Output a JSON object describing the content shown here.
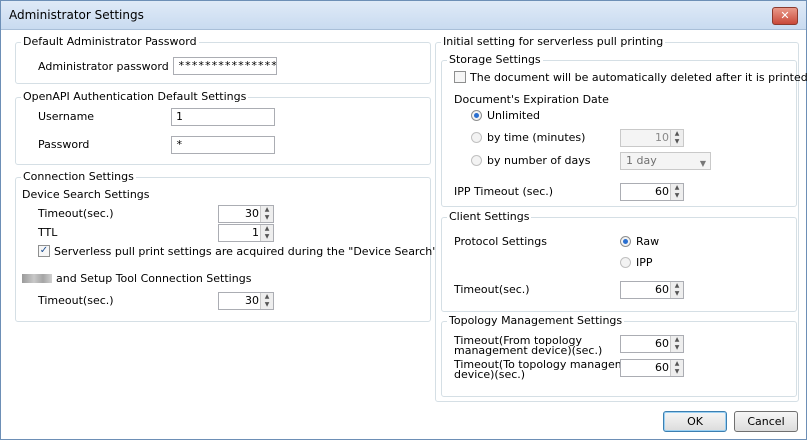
{
  "window": {
    "title": "Administrator Settings",
    "close_glyph": "✕"
  },
  "admin_pw": {
    "legend": "Default Administrator Password",
    "label": "Administrator password",
    "value": "****************"
  },
  "openapi": {
    "legend": "OpenAPI Authentication Default Settings",
    "username_label": "Username",
    "username_value": "1",
    "password_label": "Password",
    "password_value": "*"
  },
  "connection": {
    "legend": "Connection Settings",
    "device_search_title": "Device Search Settings",
    "timeout_label": "Timeout(sec.)",
    "timeout_value": "30",
    "ttl_label": "TTL",
    "ttl_value": "1",
    "serverless_check_label": "Serverless pull print settings are acquired during the \"Device Search\" process.",
    "serverless_checked": true,
    "setup_tool_title": "and Setup Tool Connection Settings",
    "setup_timeout_label": "Timeout(sec.)",
    "setup_timeout_value": "30"
  },
  "serverless": {
    "legend": "Initial setting for serverless pull printing",
    "storage": {
      "legend": "Storage Settings",
      "auto_delete_label": "The document will be automatically deleted after it is printed.",
      "auto_delete_checked": false,
      "expiration_title": "Document's Expiration Date",
      "options": [
        "Unlimited",
        "by time (minutes)",
        "by number of days"
      ],
      "selected": "Unlimited",
      "minutes_value": "10",
      "days_value": "1 day",
      "ipp_timeout_label": "IPP Timeout (sec.)",
      "ipp_timeout_value": "60"
    },
    "client": {
      "legend": "Client Settings",
      "protocol_label": "Protocol Settings",
      "protocols": [
        "Raw",
        "IPP"
      ],
      "selected_protocol": "Raw",
      "timeout_label": "Timeout(sec.)",
      "timeout_value": "60"
    },
    "topology": {
      "legend": "Topology Management Settings",
      "from_label_line1": "Timeout(From topology",
      "from_label_line2": "management device)(sec.)",
      "from_value": "60",
      "to_label_line1": "Timeout(To topology management",
      "to_label_line2": "device)(sec.)",
      "to_value": "60"
    }
  },
  "buttons": {
    "ok": "OK",
    "cancel": "Cancel"
  }
}
